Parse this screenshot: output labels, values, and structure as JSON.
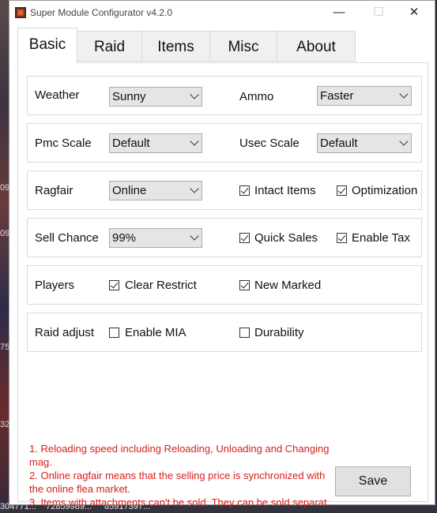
{
  "window": {
    "title": "Super Module Configurator v4.2.0"
  },
  "tabs": [
    {
      "label": "Basic",
      "active": true
    },
    {
      "label": "Raid",
      "active": false
    },
    {
      "label": "Items",
      "active": false
    },
    {
      "label": "Misc",
      "active": false
    },
    {
      "label": "About",
      "active": false
    }
  ],
  "basic": {
    "weather": {
      "label": "Weather",
      "value": "Sunny"
    },
    "ammo": {
      "label": "Ammo",
      "value": "Faster"
    },
    "pmc_scale": {
      "label": "Pmc Scale",
      "value": "Default"
    },
    "usec_scale": {
      "label": "Usec Scale",
      "value": "Default"
    },
    "ragfair": {
      "label": "Ragfair",
      "value": "Online"
    },
    "intact_items": {
      "label": "Intact Items",
      "checked": true
    },
    "optimization": {
      "label": "Optimization",
      "checked": true
    },
    "sell_chance": {
      "label": "Sell Chance",
      "value": "99%"
    },
    "quick_sales": {
      "label": "Quick Sales",
      "checked": true
    },
    "enable_tax": {
      "label": "Enable Tax",
      "checked": true
    },
    "players": {
      "label": "Players"
    },
    "clear_restrict": {
      "label": "Clear Restrict",
      "checked": true
    },
    "new_marked": {
      "label": "New Marked",
      "checked": true
    },
    "raid_adjust": {
      "label": "Raid adjust"
    },
    "enable_mia": {
      "label": "Enable MIA",
      "checked": false
    },
    "durability": {
      "label": "Durability",
      "checked": false
    }
  },
  "notes": [
    "1. Reloading speed including Reloading, Unloading and Changing mag.",
    "2. Online ragfair means that the selling price is synchronized with the online flea market.",
    "3. Items with attachments can't be sold. They can be sold separat..."
  ],
  "save_label": "Save",
  "desktop": {
    "side_numbers": [
      "09",
      "09",
      "75",
      "32"
    ],
    "bottom_texts": [
      "304771...",
      "72859989...",
      "85917397..."
    ]
  },
  "colors": {
    "note_text": "#d6211b",
    "accent": "#0078d7"
  }
}
